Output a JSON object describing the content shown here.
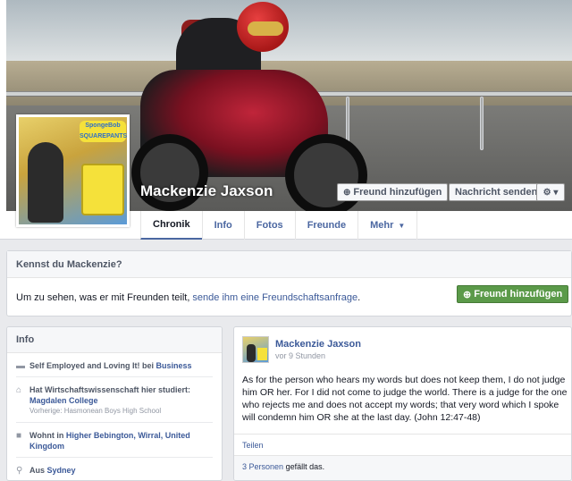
{
  "profile": {
    "name": "Mackenzie Jaxson",
    "add_friend_label": "Freund hinzufügen",
    "message_label": "Nachricht senden",
    "gear_icon": "gear-icon",
    "pic_logo_text": "SpongeBob SQUAREPANTS"
  },
  "tabs": [
    {
      "label": "Chronik",
      "active": true
    },
    {
      "label": "Info"
    },
    {
      "label": "Fotos"
    },
    {
      "label": "Freunde"
    },
    {
      "label": "Mehr"
    }
  ],
  "know": {
    "title": "Kennst du Mackenzie?",
    "text": "Um zu sehen, was er mit Freunden teilt,",
    "link": "sende ihm eine Freundschaftsanfrage",
    "suffix": ".",
    "button_label": "Freund hinzufügen"
  },
  "info": {
    "title": "Info",
    "work_prefix": "Self Employed and Loving It! bei",
    "work_link": "Business",
    "study_prefix": "Hat Wirtschaftswissenschaft hier studiert:",
    "study_link": "Magdalen College",
    "study_sub": "Vorherige: Hasmonean Boys High School",
    "lives_prefix": "Wohnt in",
    "lives_link": "Higher Bebington, Wirral, United Kingdom",
    "from_prefix": "Aus",
    "from_link": "Sydney"
  },
  "post": {
    "author": "Mackenzie Jaxson",
    "time": "vor 9 Stunden",
    "text": "As for the person who hears my words but does not keep them, I do not judge him OR her. For I did not come to judge the world. There is a judge for the one who rejects me and does not accept my words; that very word which I spoke will condemn him OR she at the last day. (John 12:47-48)",
    "share_label": "Teilen",
    "likes_link": "3 Personen",
    "likes_suffix": "gefällt das."
  },
  "colors": {
    "link": "#3b5998",
    "green_button": "#5b9a49",
    "page_bg": "#e9eaed"
  }
}
